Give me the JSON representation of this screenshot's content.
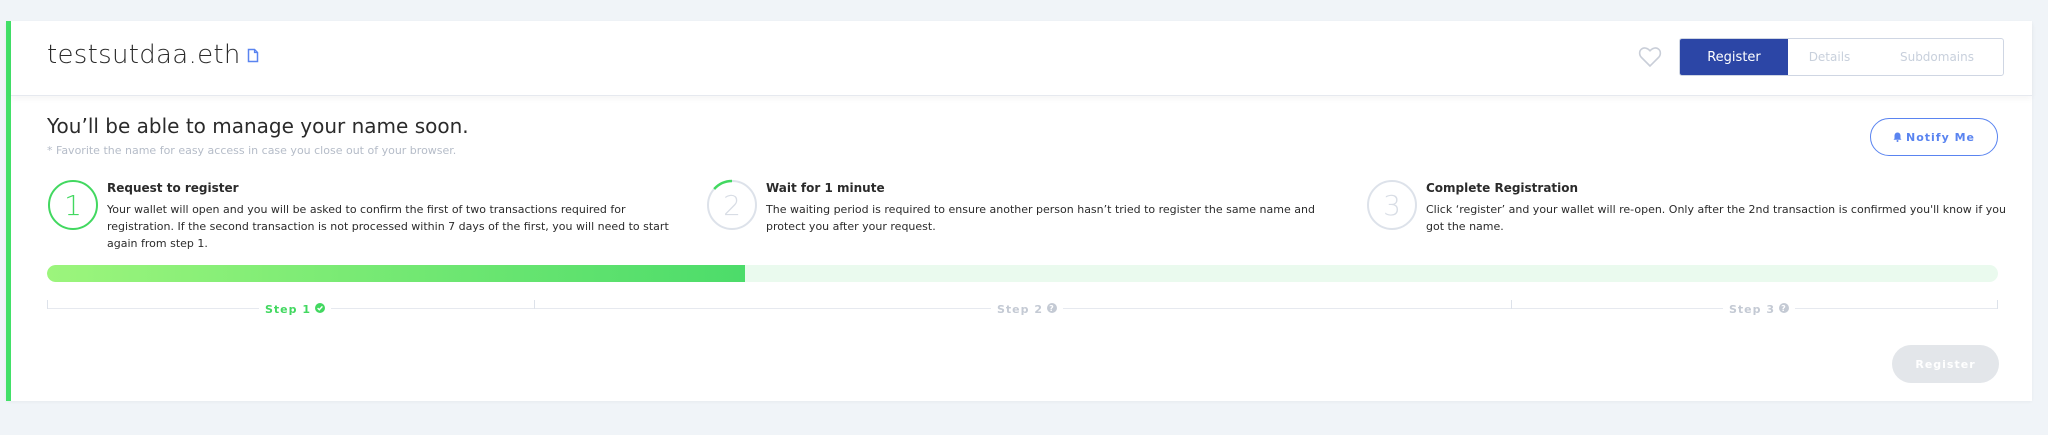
{
  "header": {
    "domain_name": "testsutdaa.eth",
    "tabs": [
      {
        "label": "Register",
        "active": true
      },
      {
        "label": "Details",
        "active": false
      },
      {
        "label": "Subdomains",
        "active": false
      }
    ]
  },
  "main": {
    "heading": "You’ll be able to manage your name soon.",
    "note": "* Favorite the name for easy access in case you close out of your browser.",
    "notify_label": "Notify Me"
  },
  "steps": [
    {
      "number": "1",
      "title": "Request to register",
      "text": "Your wallet will open and you will be asked to confirm the first of two transactions required for registration. If the second transaction is not processed within 7 days of the first, you will need to start again from step 1."
    },
    {
      "number": "2",
      "title": "Wait for 1 minute",
      "text": "The waiting period is required to ensure another person hasn’t tried to register the same name and protect you after your request."
    },
    {
      "number": "3",
      "title": "Complete Registration",
      "text": "Click ‘register’ and your wallet will re-open. Only after the 2nd transaction is confirmed you'll know if you got the name."
    }
  ],
  "progress": {
    "fraction": 0.358,
    "step_labels": [
      "Step 1",
      "Step 2",
      "Step 3"
    ]
  },
  "footer": {
    "register_label": "Register"
  },
  "colors": {
    "accent_green": "#42e068",
    "primary_blue": "#2c46a6",
    "link_blue": "#5a84f0",
    "muted": "#c4cad4"
  }
}
